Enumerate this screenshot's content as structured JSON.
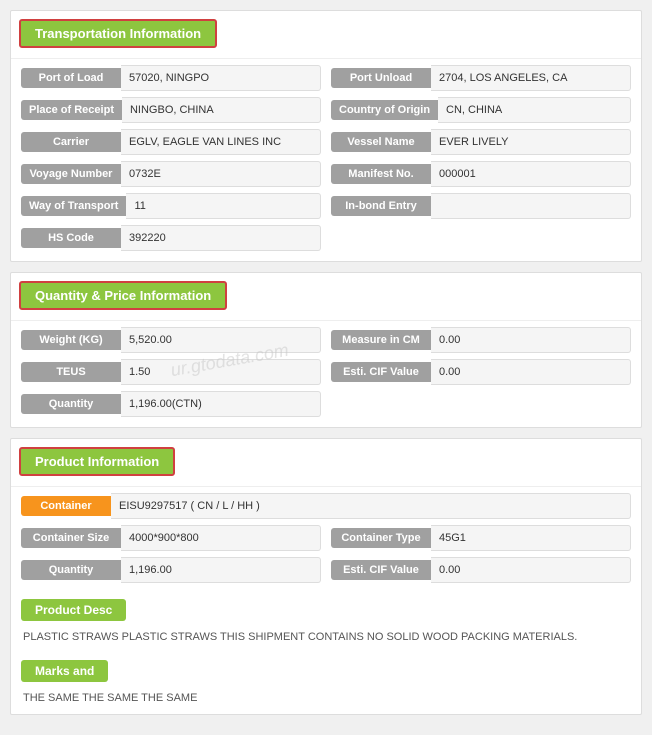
{
  "transportation": {
    "header": "Transportation Information",
    "fields_left": [
      {
        "label": "Port of Load",
        "value": "57020, NINGPO"
      },
      {
        "label": "Place of Receipt",
        "value": "NINGBO, CHINA"
      },
      {
        "label": "Carrier",
        "value": "EGLV, EAGLE VAN LINES INC"
      },
      {
        "label": "Voyage Number",
        "value": "0732E"
      },
      {
        "label": "Way of Transport",
        "value": "11"
      },
      {
        "label": "HS Code",
        "value": "392220"
      }
    ],
    "fields_right": [
      {
        "label": "Port Unload",
        "value": "2704, LOS ANGELES, CA"
      },
      {
        "label": "Country of Origin",
        "value": "CN, CHINA"
      },
      {
        "label": "Vessel Name",
        "value": "EVER LIVELY"
      },
      {
        "label": "Manifest No.",
        "value": "000001"
      },
      {
        "label": "In-bond Entry",
        "value": ""
      },
      {
        "label": "",
        "value": ""
      }
    ]
  },
  "quantity": {
    "header": "Quantity & Price Information",
    "fields_left": [
      {
        "label": "Weight (KG)",
        "value": "5,520.00"
      },
      {
        "label": "TEUS",
        "value": "1.50"
      },
      {
        "label": "Quantity",
        "value": "1,196.00(CTN)"
      }
    ],
    "fields_right": [
      {
        "label": "Measure in CM",
        "value": "0.00"
      },
      {
        "label": "Esti. CIF Value",
        "value": "0.00"
      },
      {
        "label": "",
        "value": ""
      }
    ]
  },
  "product": {
    "header": "Product Information",
    "container_label": "Container",
    "container_value": "EISU9297517 ( CN / L / HH )",
    "fields_left": [
      {
        "label": "Container Size",
        "value": "4000*900*800"
      },
      {
        "label": "Quantity",
        "value": "1,196.00"
      }
    ],
    "fields_right": [
      {
        "label": "Container Type",
        "value": "45G1"
      },
      {
        "label": "Esti. CIF Value",
        "value": "0.00"
      }
    ],
    "product_desc_label": "Product Desc",
    "product_desc_text": "PLASTIC STRAWS PLASTIC STRAWS THIS SHIPMENT CONTAINS NO SOLID WOOD PACKING MATERIALS.",
    "marks_label": "Marks and",
    "marks_text": "THE SAME THE SAME THE SAME"
  },
  "watermark": "ur.gtodata.com"
}
